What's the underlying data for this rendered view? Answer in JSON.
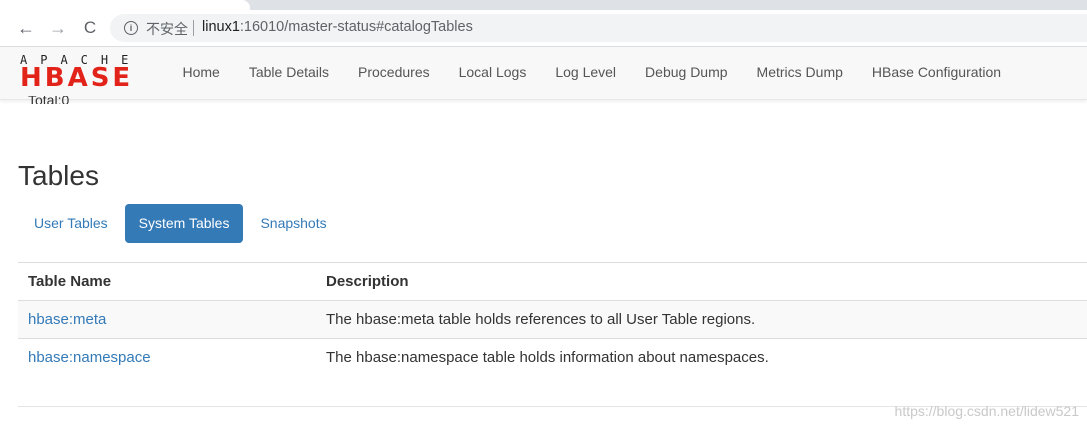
{
  "browser": {
    "security_label": "不安全",
    "url_host": "linux1",
    "url_rest": ":16010/master-status#catalogTables"
  },
  "navbar": {
    "logo_top": "APACHE",
    "logo_main": "HBASE",
    "links": [
      {
        "label": "Home"
      },
      {
        "label": "Table Details"
      },
      {
        "label": "Procedures"
      },
      {
        "label": "Local Logs"
      },
      {
        "label": "Log Level"
      },
      {
        "label": "Debug Dump"
      },
      {
        "label": "Metrics Dump"
      },
      {
        "label": "HBase Configuration"
      }
    ]
  },
  "content": {
    "total_text": "Total:0",
    "tables_heading": "Tables",
    "tabs": [
      {
        "label": "User Tables",
        "active": false
      },
      {
        "label": "System Tables",
        "active": true
      },
      {
        "label": "Snapshots",
        "active": false
      }
    ],
    "table": {
      "headers": [
        "Table Name",
        "Description"
      ],
      "rows": [
        {
          "name": "hbase:meta",
          "description": "The hbase:meta table holds references to all User Table regions."
        },
        {
          "name": "hbase:namespace",
          "description": "The hbase:namespace table holds information about namespaces."
        }
      ]
    },
    "watermark": "https://blog.csdn.net/lidew521"
  },
  "colors": {
    "link": "#337ab7",
    "hbase_red": "#e2231a",
    "active_pill": "#337ab7"
  }
}
